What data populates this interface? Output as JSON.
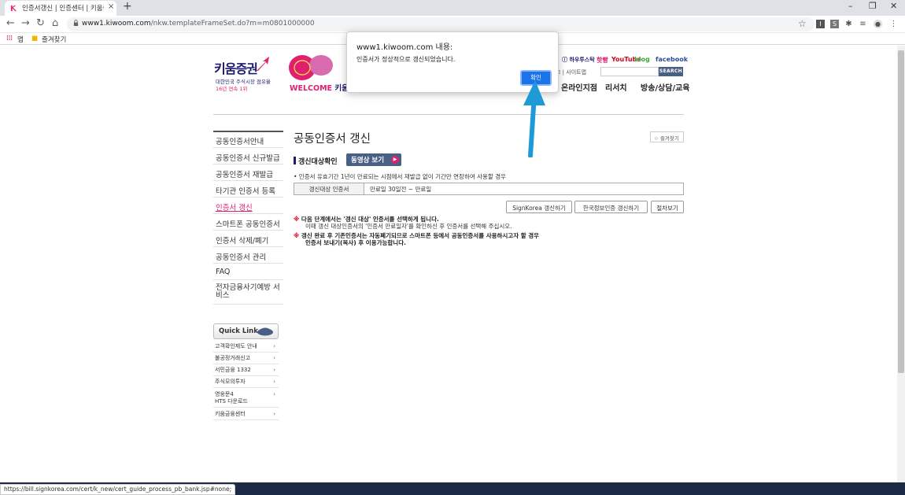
{
  "browser": {
    "tab_title": "인증서갱신 | 인증센터 | 키움증권",
    "tab_close": "×",
    "new_tab": "+",
    "url_host": "www1.kiwoom.com",
    "url_path": "/nkw.templateFrameSet.do?m=m0801000000",
    "bookmarks": [
      {
        "label": "앱"
      },
      {
        "label": "즐겨찾기"
      }
    ],
    "status_url": "https://bill.signkorea.com/cert/k_new/cert_guide_process_pb_bank.jsp#none;"
  },
  "header": {
    "logo": "키움증권",
    "logo_sub1": "대한민국 주식시장 점유율",
    "logo_sub2": "16년 연속 1위",
    "welcome": "WELCOME",
    "welcome_k": "키움",
    "social": [
      "하우투스탁",
      "핫빵",
      "YouTube",
      "blog",
      "facebook"
    ],
    "top_links": "고 | 사이트맵",
    "search_button": "SEARCH",
    "gnb": [
      "온라인지점",
      "리서치",
      "방송/상담/교육"
    ]
  },
  "lnb": {
    "items": [
      {
        "label": "공동인증서안내"
      },
      {
        "label": "공동인증서 신규발급"
      },
      {
        "label": "공동인증서 재발급"
      },
      {
        "label": "타기관 인증서 등록"
      },
      {
        "label": "인증서 갱신"
      },
      {
        "label": "스마트폰 공동인증서"
      },
      {
        "label": "인증서 삭제/폐기"
      },
      {
        "label": "공동인증서 관리"
      },
      {
        "label": "FAQ"
      },
      {
        "label": "전자금융사기예방 서비스"
      }
    ],
    "quick_link": "Quick Link",
    "quick_items": [
      {
        "label": "고객확인제도 안내"
      },
      {
        "label": "불공정거래신고"
      },
      {
        "label": "서민금융 1332"
      },
      {
        "label": "주식모의투자"
      },
      {
        "label": "영웅문4\nHTS 다운로드"
      },
      {
        "label": "키움금융센터"
      }
    ]
  },
  "content": {
    "title": "공동인증서 갱신",
    "favorite": "즐겨찾기",
    "section_title": "갱신대상확인",
    "video_button": "동영상 보기",
    "note": "• 인증서 유효기간 1년이 만료되는 시점에서 재발급 없이 기간만 연장하여 사용할 경우",
    "table_header": "갱신대상 인증서",
    "table_value": "만료일 30일전 ~ 만료일",
    "buttons": [
      "SignKorea 갱신하기",
      "한국정보인증 갱신하기",
      "절차보기"
    ],
    "warn1": "다음 단계에서는 '갱신 대상' 인증서를 선택하게 됩니다.",
    "warn1_sub": "이때 갱신 대상인증서의 '인증서 만료일자'를 확인하신 후 인증서를 선택해 주십시오.",
    "warn2": "갱신 완료 후 기존인증서는 자동폐기되므로 스마트폰 등에서 공동인증서를 사용하시고자 할 경우",
    "warn2_cont": "인증서 보내기(복사) 후 이용가능합니다.",
    "warn_mark": "※"
  },
  "dialog": {
    "title": "www1.kiwoom.com 내용:",
    "message": "인증서가 정상적으로 갱신되었습니다.",
    "ok": "확인"
  },
  "colors": {
    "brand_navy": "#1b1b6f",
    "brand_pink": "#e0206e",
    "dialog_blue": "#1a73e8",
    "arrow_blue": "#1e9ad6"
  }
}
